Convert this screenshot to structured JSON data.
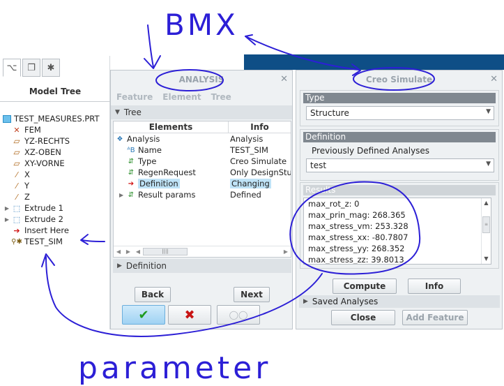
{
  "model_tree": {
    "title": "Model Tree",
    "tabs": [
      {
        "icon": "tree-view-icon",
        "glyph": "⌥"
      },
      {
        "icon": "folder-browser-icon",
        "glyph": "❐"
      },
      {
        "icon": "favorites-icon",
        "glyph": "✱"
      }
    ],
    "items": [
      {
        "label": "TEST_MEASURES.PRT",
        "icon": "part-icon",
        "expander": ""
      },
      {
        "label": "FEM",
        "icon": "fem-icon",
        "expander": ""
      },
      {
        "label": "YZ-RECHTS",
        "icon": "datum-plane-icon",
        "expander": ""
      },
      {
        "label": "XZ-OBEN",
        "icon": "datum-plane-icon",
        "expander": ""
      },
      {
        "label": "XY-VORNE",
        "icon": "datum-plane-icon",
        "expander": ""
      },
      {
        "label": "X",
        "icon": "datum-axis-icon",
        "expander": ""
      },
      {
        "label": "Y",
        "icon": "datum-axis-icon",
        "expander": ""
      },
      {
        "label": "Z",
        "icon": "datum-axis-icon",
        "expander": ""
      },
      {
        "label": "Extrude 1",
        "icon": "extrude-icon",
        "expander": "▶"
      },
      {
        "label": "Extrude 2",
        "icon": "extrude-icon",
        "expander": "▶"
      },
      {
        "label": "Insert Here",
        "icon": "insert-here-icon",
        "expander": ""
      },
      {
        "label": "TEST_SIM",
        "icon": "simulation-feature-icon",
        "expander": ""
      }
    ]
  },
  "analysis_dialog": {
    "title": "ANALYSIS",
    "close": "✕",
    "menu": [
      "Feature",
      "Element",
      "Tree"
    ],
    "tree_section": "Tree",
    "columns": {
      "elements": "Elements",
      "info": "Info"
    },
    "rows": [
      {
        "element": "Analysis",
        "info": "Analysis",
        "icon": "analysis-icon",
        "indent": 0,
        "expander": ""
      },
      {
        "element": "Name",
        "info": "TEST_SIM",
        "icon": "name-element-icon",
        "indent": 1,
        "expander": ""
      },
      {
        "element": "Type",
        "info": "Creo Simulate",
        "icon": "type-element-icon",
        "indent": 1,
        "expander": ""
      },
      {
        "element": "RegenRequest",
        "info": "Only DesignStud",
        "icon": "regen-element-icon",
        "indent": 1,
        "expander": ""
      },
      {
        "element": "Definition",
        "info": "Changing",
        "icon": "red-arrow-icon",
        "indent": 1,
        "expander": "",
        "highlight": true
      },
      {
        "element": "Result params",
        "info": "Defined",
        "icon": "result-params-icon",
        "indent": 1,
        "expander": "▶"
      }
    ],
    "definition_section": "Definition",
    "back_label": "Back",
    "next_label": "Next",
    "ok_glyph": "✔",
    "cancel_glyph": "✖",
    "preview_glyph": "◯◯"
  },
  "simulate_dialog": {
    "title": "Creo Simulate",
    "close": "✕",
    "type_label": "Type",
    "type_value": "Structure",
    "definition_label": "Definition",
    "previously_defined_label": "Previously Defined Analyses",
    "analysis_value": "test",
    "results_label": "Results",
    "results": [
      "max_rot_z:  0",
      "max_prin_mag:  268.365",
      "max_stress_vm:  253.328",
      "max_stress_xx:  -80.7807",
      "max_stress_yy:  268.352",
      "max_stress_zz:  39.8013"
    ],
    "compute_label": "Compute",
    "info_label": "Info",
    "saved_analyses_label": "Saved Analyses",
    "close_label": "Close",
    "add_feature_label": "Add Feature"
  },
  "annotations": {
    "color": "#2c1fd6",
    "top_text": "BMX",
    "bottom_text": "parameter"
  }
}
